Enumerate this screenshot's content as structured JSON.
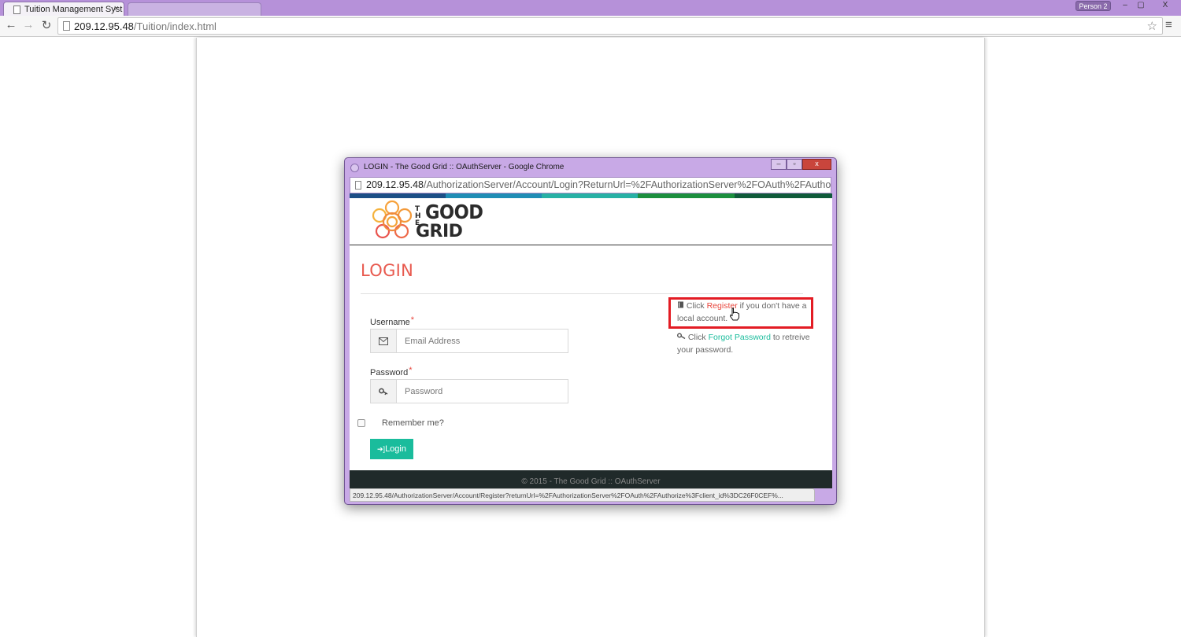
{
  "browser": {
    "tab_title": "Tuition Management Syst",
    "tab_close": "×",
    "profile": "Person 2",
    "address": {
      "host": "209.12.95.48",
      "path": "/Tuition/index.html"
    },
    "nav": {
      "back": "←",
      "forward": "→",
      "reload": "↻"
    },
    "window_buttons": {
      "minimize": "–",
      "maximize": "▢",
      "close": "X"
    },
    "star": "☆",
    "menu": "≡"
  },
  "popup": {
    "window_title": "LOGIN - The Good Grid :: OAuthServer - Google Chrome",
    "window_buttons": {
      "minimize": "–",
      "maximize": "▫",
      "close": "x"
    },
    "address": {
      "host": "209.12.95.48",
      "path": "/AuthorizationServer/Account/Login?ReturnUrl=%2FAuthorizationServer%2FOAuth%2FAuthor"
    },
    "logo": {
      "the": "THE",
      "good": "GOOD",
      "grid": "GRID"
    },
    "stripe_colors": [
      "#1c4f86",
      "#1f8db5",
      "#27b1a5",
      "#1c8f3e",
      "#0f5a3a"
    ],
    "heading": "LOGIN",
    "username": {
      "label": "Username",
      "required_mark": "*",
      "placeholder": "Email Address",
      "icon": "envelope-icon"
    },
    "password": {
      "label": "Password",
      "required_mark": "*",
      "placeholder": "Password",
      "icon": "key-icon"
    },
    "remember_label": "Remember me?",
    "login_button": {
      "icon": "➔]",
      "label": "Login"
    },
    "register_info": {
      "icon": "book-icon",
      "prefix": "Click ",
      "link": "Register",
      "suffix": " if you don't have a local account."
    },
    "forgot_info": {
      "icon": "key-icon",
      "prefix": "Click ",
      "link": "Forgot Password",
      "suffix": " to retreive your password."
    },
    "footer": "© 2015 - The Good Grid :: OAuthServer",
    "status_url": "209.12.95.48/AuthorizationServer/Account/Register?returnUrl=%2FAuthorizationServer%2FOAuth%2FAuthorize%3Fclient_id%3DC26F0CEF%...",
    "highlight_color": "#e31c24",
    "accent_color": "#1abc9c",
    "heading_color": "#e85a4f"
  }
}
